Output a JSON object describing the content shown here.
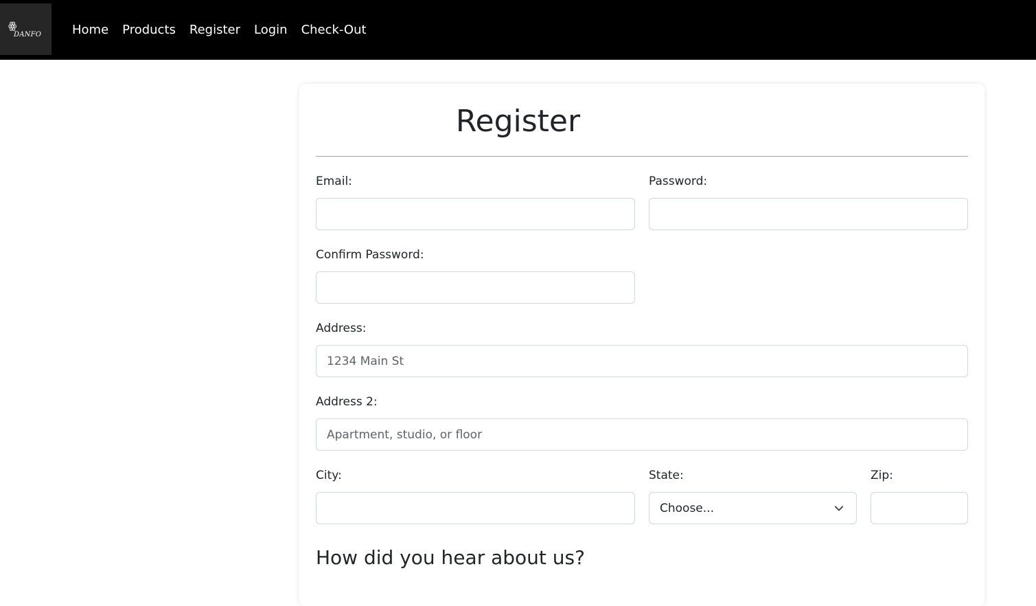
{
  "brand": {
    "logo_text": "DANFO",
    "logo_glyph": "ꙮ"
  },
  "nav": {
    "items": [
      {
        "label": "Home"
      },
      {
        "label": "Products"
      },
      {
        "label": "Register"
      },
      {
        "label": "Login"
      },
      {
        "label": "Check-Out"
      }
    ]
  },
  "form": {
    "title": "Register",
    "email": {
      "label": "Email:",
      "value": "",
      "placeholder": ""
    },
    "password": {
      "label": "Password:",
      "value": "",
      "placeholder": ""
    },
    "confirm_password": {
      "label": "Confirm Password:",
      "value": "",
      "placeholder": ""
    },
    "address": {
      "label": "Address:",
      "value": "",
      "placeholder": "1234 Main St"
    },
    "address2": {
      "label": "Address 2:",
      "value": "",
      "placeholder": "Apartment, studio, or floor"
    },
    "city": {
      "label": "City:",
      "value": "",
      "placeholder": ""
    },
    "state": {
      "label": "State:",
      "selected": "Choose..."
    },
    "zip": {
      "label": "Zip:",
      "value": "",
      "placeholder": ""
    },
    "how_heard_heading": "How did you hear about us?"
  },
  "colors": {
    "navbar_bg": "#000000",
    "logo_bg": "#262626",
    "nav_text": "#ffffff",
    "input_border": "#d3d6da",
    "divider": "#a8a8a8"
  },
  "icons": {
    "state_dropdown": "chevron-down-icon"
  }
}
